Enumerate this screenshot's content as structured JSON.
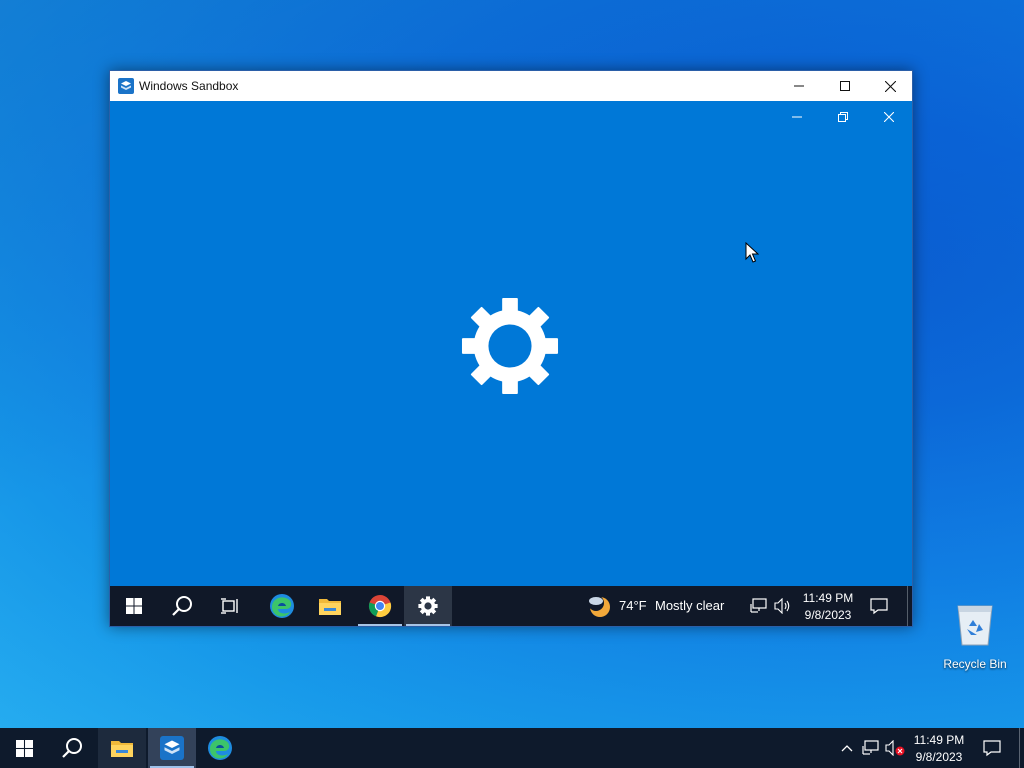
{
  "window": {
    "title": "Windows Sandbox",
    "controls": {
      "minimize": "minimize",
      "maximize": "maximize",
      "close": "close"
    }
  },
  "sandbox_taskbar": {
    "pinned": [
      "start-icon",
      "search-icon",
      "task-view-icon",
      "edge-icon",
      "file-explorer-icon",
      "chrome-icon",
      "settings-icon"
    ],
    "weather": {
      "temperature": "74°F",
      "condition": "Mostly clear"
    },
    "clock": {
      "time": "11:49 PM",
      "date": "9/8/2023"
    }
  },
  "desktop": {
    "icons": [
      {
        "label": "Recycle Bin"
      }
    ]
  },
  "taskbar": {
    "pinned": [
      "start-icon",
      "search-icon",
      "file-explorer-icon",
      "windows-sandbox-icon",
      "edge-icon"
    ],
    "clock": {
      "time": "11:49 PM",
      "date": "9/8/2023"
    }
  },
  "colors": {
    "sandbox_background": "#0078d7",
    "taskbar": "#0e1a2c",
    "inner_taskbar": "#101828",
    "accent_underline": "#9fc2ea"
  }
}
